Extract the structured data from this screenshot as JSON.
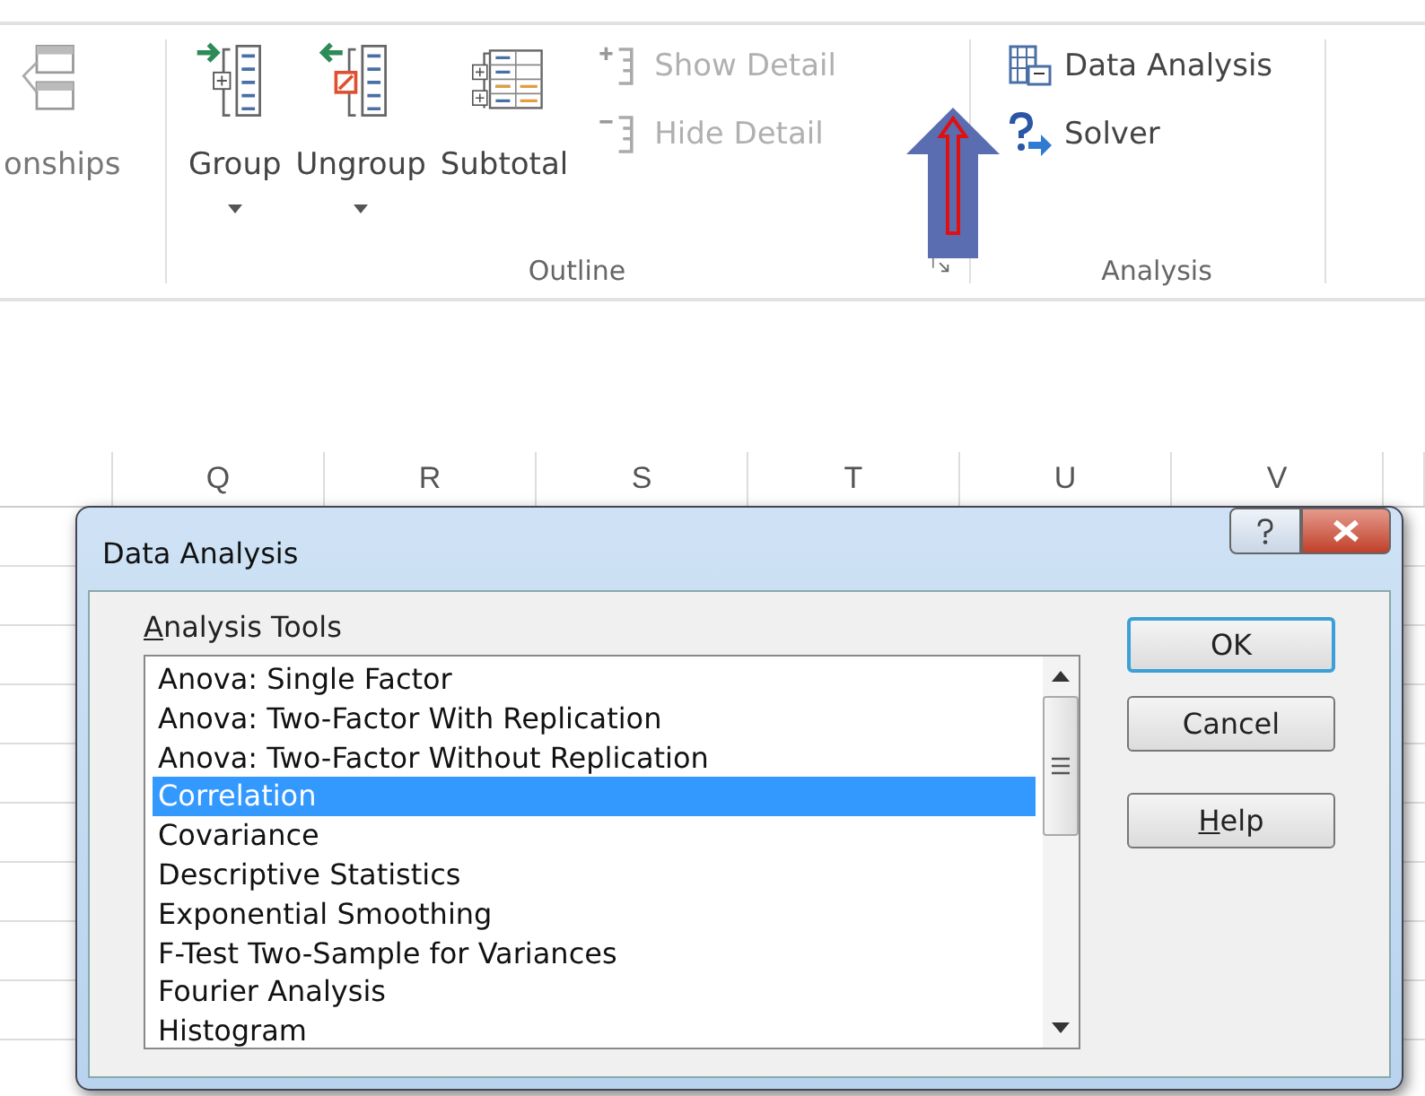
{
  "ribbon": {
    "groups": [
      {
        "buttons": [
          {
            "kind": "large",
            "label": "onships",
            "disabled": false,
            "dropdown": false
          }
        ]
      },
      {
        "label": "Outline",
        "launcher": true,
        "buttons": [
          {
            "kind": "large",
            "label": "Group",
            "disabled": false,
            "dropdown": true
          },
          {
            "kind": "large",
            "label": "Ungroup",
            "disabled": false,
            "dropdown": true
          },
          {
            "kind": "large",
            "label": "Subtotal",
            "disabled": false,
            "dropdown": false
          },
          {
            "kind": "small",
            "label": "Show Detail",
            "disabled": true
          },
          {
            "kind": "small",
            "label": "Hide Detail",
            "disabled": true
          }
        ]
      },
      {
        "label": "Analysis",
        "launcher": false,
        "buttons": [
          {
            "kind": "small",
            "label": "Data Analysis",
            "disabled": false
          },
          {
            "kind": "small",
            "label": "Solver",
            "disabled": false
          }
        ]
      }
    ]
  },
  "sheet": {
    "columns": [
      "Q",
      "R",
      "S",
      "T",
      "U",
      "V"
    ]
  },
  "dialog": {
    "title": "Data Analysis",
    "list_label": "Analysis Tools",
    "list_label_mnemonic": true,
    "items": [
      {
        "label": "Anova: Single Factor",
        "selected": false
      },
      {
        "label": "Anova: Two-Factor With Replication",
        "selected": false
      },
      {
        "label": "Anova: Two-Factor Without Replication",
        "selected": false
      },
      {
        "label": "Correlation",
        "selected": true
      },
      {
        "label": "Covariance",
        "selected": false
      },
      {
        "label": "Descriptive Statistics",
        "selected": false
      },
      {
        "label": "Exponential Smoothing",
        "selected": false
      },
      {
        "label": "F-Test Two-Sample for Variances",
        "selected": false
      },
      {
        "label": "Fourier Analysis",
        "selected": false
      },
      {
        "label": "Histogram",
        "selected": false
      }
    ],
    "buttons": [
      {
        "label": "OK",
        "default": true,
        "mnemonic": false
      },
      {
        "label": "Cancel",
        "default": false,
        "mnemonic": false
      },
      {
        "label": "Help",
        "default": false,
        "mnemonic": true
      }
    ]
  }
}
